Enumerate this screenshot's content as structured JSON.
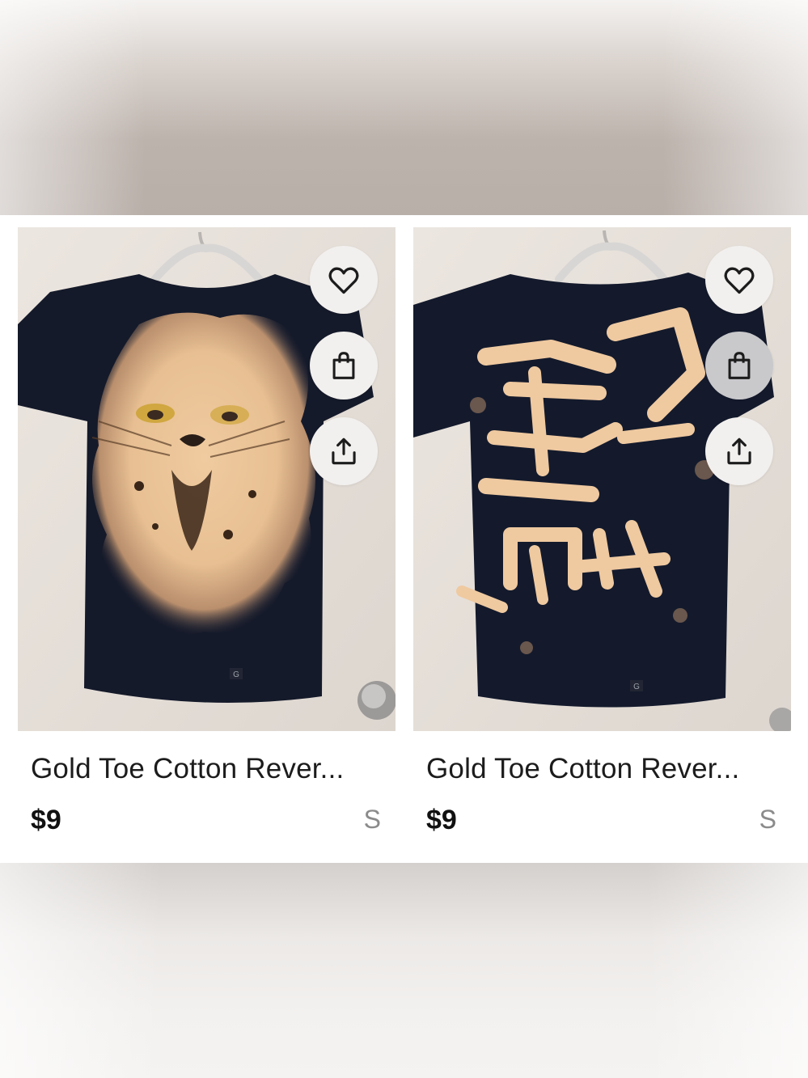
{
  "colors": {
    "background": "#ffffff",
    "text_primary": "#1c1c1c",
    "text_secondary": "#8b8b8b",
    "action_button_bg": "#f2f0ee",
    "shirt_dark": "#151a2a",
    "bleach_tan": "#e8c39a"
  },
  "listings": [
    {
      "title": "Gold Toe Cotton Rever...",
      "price": "$9",
      "size": "S",
      "tag_letter": "G",
      "icons": [
        "heart-icon",
        "shopping-bag-icon",
        "share-icon"
      ]
    },
    {
      "title": "Gold Toe Cotton Rever...",
      "price": "$9",
      "size": "S",
      "tag_letter": "G",
      "icons": [
        "heart-icon",
        "shopping-bag-icon",
        "share-icon"
      ]
    }
  ]
}
